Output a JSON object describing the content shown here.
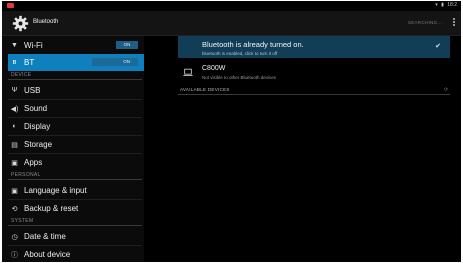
{
  "status_bar": {
    "time": "18:2",
    "wifi_glyph": "▾",
    "battery_glyph": "▮"
  },
  "action_bar": {
    "title": "Bluetooth",
    "search_label": "SEARCHING..."
  },
  "sidebar": {
    "items": [
      {
        "id": "wifi",
        "label": "Wi-Fi",
        "icon": "wifi-icon",
        "glyph": "▼",
        "toggle": "ON"
      },
      {
        "id": "bt",
        "label": "BT",
        "icon": "bluetooth-icon",
        "glyph": "ʙ",
        "toggle": "ON",
        "selected": true
      },
      {
        "id": "usb",
        "label": "USB",
        "icon": "usb-icon",
        "glyph": "Ψ"
      },
      {
        "id": "sound",
        "label": "Sound",
        "icon": "sound-icon",
        "glyph": "◀)"
      },
      {
        "id": "display",
        "label": "Display",
        "icon": "display-icon",
        "glyph": "◐"
      },
      {
        "id": "storage",
        "label": "Storage",
        "icon": "storage-icon",
        "glyph": "▤"
      },
      {
        "id": "apps",
        "label": "Apps",
        "icon": "apps-icon",
        "glyph": "▣"
      },
      {
        "id": "language",
        "label": "Language & input",
        "icon": "language-icon",
        "glyph": "▣"
      },
      {
        "id": "backup",
        "label": "Backup & reset",
        "icon": "backup-icon",
        "glyph": "⟲"
      },
      {
        "id": "datetime",
        "label": "Date & time",
        "icon": "clock-icon",
        "glyph": "◷"
      },
      {
        "id": "about",
        "label": "About device",
        "icon": "info-icon",
        "glyph": "ⓘ"
      }
    ],
    "headers": {
      "device": "DEVICE",
      "personal": "PERSONAL",
      "system": "SYSTEM"
    }
  },
  "detail": {
    "bluetooth_status": {
      "title": "Bluetooth is already turned on.",
      "subtitle": "bluetooth is enabled, click to turn it off"
    },
    "device": {
      "name": "C800W",
      "subtitle": "Not visible to other Bluetooth devices"
    },
    "available_header": "AVAILABLE DEVICES"
  },
  "colors": {
    "accent": "#0f7fbe",
    "selected_row": "#123d57",
    "background": "#000000"
  }
}
